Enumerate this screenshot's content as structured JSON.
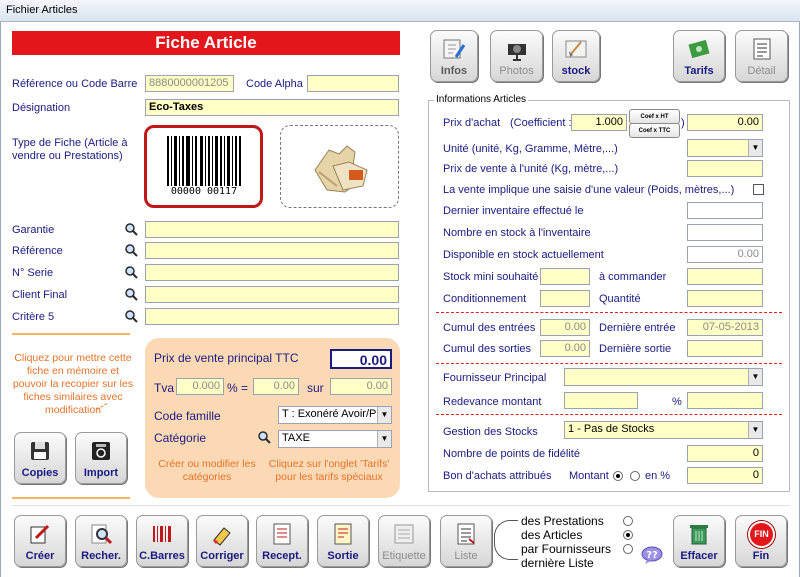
{
  "window": {
    "title": "Fichier Articles"
  },
  "header": {
    "banner": "Fiche Article"
  },
  "top_buttons": {
    "infos": "Infos",
    "photos": "Photos",
    "stock": "stock",
    "tarifs": "Tarifs",
    "detail": "Détail"
  },
  "left": {
    "reference_label": "Référence ou Code Barre",
    "reference_value": "8880000001205",
    "code_alpha_label": "Code Alpha",
    "code_alpha_value": "",
    "designation_label": "Désignation",
    "designation_value": "Eco-Taxes",
    "type_fiche_label": "Type de Fiche (Article à vendre ou Prestations)",
    "barcode_digits": "00000 00117",
    "garantie_label": "Garantie",
    "reference2_label": "Référence",
    "serie_label": "N° Serie",
    "client_final_label": "Client Final",
    "critere5_label": "Critère 5",
    "memo_hint": "Cliquez pour mettre cette fiche en mémoire et pouvoir la recopier sur les fiches similaires avec modification",
    "copies_label": "Copies",
    "import_label": "Import"
  },
  "price_panel": {
    "prix_label": "Prix de vente principal TTC",
    "prix_value": "0.00",
    "tva_label": "Tva",
    "tva_value": "0.000",
    "pct_eq": "% =",
    "tva_amount": "0.00",
    "sur_label": "sur",
    "sur_value": "0.00",
    "code_famille_label": "Code famille",
    "code_famille_value": "T : Exonéré Avoir/P",
    "categorie_label": "Catégorie",
    "categorie_value": "TAXE",
    "hint_categories": "Créer ou modifier les catégories",
    "hint_tarifs": "Cliquez sur l'onglet 'Tarifs' pour les tarifs spéciaux"
  },
  "info": {
    "group_title": "Informations Articles",
    "prix_achat_label": "Prix d'achat",
    "coefficient_label": "(Coefficient :",
    "coefficient_value": "1.000",
    "coef_ht": "Coef x HT",
    "coef_ttc": "Coef x TTC",
    "close_paren": ")",
    "prix_achat_value": "0.00",
    "unite_label": "Unité (unité, Kg, Gramme, Mètre,...)",
    "prix_unite_label": "Prix de vente à l'unité (Kg, mètre,...)",
    "saisie_label": "La vente implique une saisie d'une valeur (Poids, mètres,...)",
    "dernier_inv_label": "Dernier inventaire effectué le",
    "nb_stock_inv_label": "Nombre en stock à l'inventaire",
    "disponible_label": "Disponible en stock actuellement",
    "disponible_value": "0.00",
    "stock_mini_label": "Stock mini souhaité",
    "a_commander_label": "à commander",
    "conditionnement_label": "Conditionnement",
    "quantite_label": "Quantité",
    "cumul_entrees_label": "Cumul des entrées",
    "cumul_entrees_value": "0.00",
    "derniere_entree_label": "Dernière entrée",
    "derniere_entree_value": "07-05-2013",
    "cumul_sorties_label": "Cumul des sorties",
    "cumul_sorties_value": "0.00",
    "derniere_sortie_label": "Dernière sortie",
    "fournisseur_label": "Fournisseur Principal",
    "redevance_label": "Redevance montant",
    "pct": "%",
    "gestion_label": "Gestion des Stocks",
    "gestion_value": "1 - Pas de Stocks",
    "fidelite_label": "Nombre de points de fidélité",
    "fidelite_value": "0",
    "bon_achats_label": "Bon d'achats attribués",
    "montant_label": "Montant",
    "en_pct_label": "en %",
    "bon_value": "0"
  },
  "bottom": {
    "creer": "Créer",
    "recher": "Recher.",
    "cbarres": "C.Barres",
    "corriger": "Corriger",
    "recept": "Recept.",
    "sortie": "Sortie",
    "etiquette": "Etiquette",
    "liste": "Liste",
    "opt_prestations": "des Prestations",
    "opt_articles": "des Articles",
    "opt_fournisseurs": "par Fournisseurs",
    "opt_derniere": "dernière Liste",
    "effacer": "Effacer",
    "fin": "Fin",
    "fin_icon_text": "FIN"
  },
  "colors": {
    "accent_red": "#e2161b",
    "field_yellow": "#ffffc6",
    "panel_peach": "#fbd9b5",
    "label_navy": "#1a1a80",
    "hint_orange": "#e5732a"
  }
}
